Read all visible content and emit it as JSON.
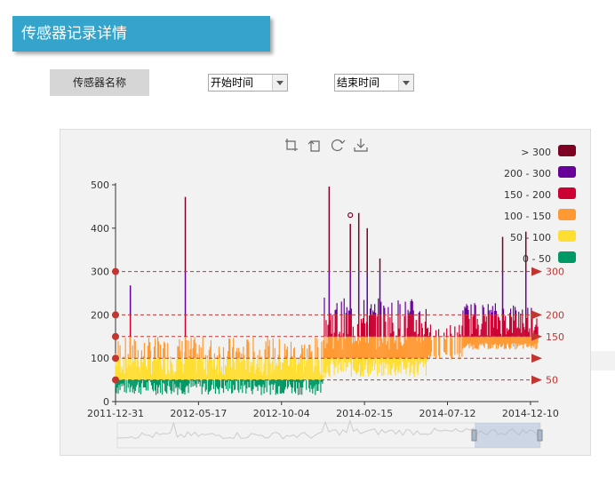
{
  "header": {
    "title": "传感器记录详情"
  },
  "filters": {
    "sensor_name_label": "传感器名称",
    "start_time": "开始时间",
    "end_time": "结束时间"
  },
  "toolbox": [
    "zoom-icon",
    "zoom-reset-icon",
    "restore-icon",
    "download-icon"
  ],
  "colors": {
    "panel_bg": "#f2f2f2",
    "above_300": "#7e0023",
    "200_300": "#660099",
    "150_200": "#cc0033",
    "100_150": "#ff9933",
    "50_100": "#ffde33",
    "0_50": "#096",
    "markline": "#c23531"
  },
  "chart_data": {
    "type": "line",
    "x_ticks": [
      "2011-12-31",
      "2012-05-17",
      "2012-10-04",
      "2014-02-15",
      "2014-07-12",
      "2014-12-10"
    ],
    "y_ticks": [
      0,
      100,
      200,
      300,
      400,
      500
    ],
    "ylim": [
      0,
      500
    ],
    "grid": false,
    "legend_position": "top-right",
    "visual_pieces": [
      {
        "label": "> 300",
        "min": 300,
        "max": 500,
        "color": "#7e0023"
      },
      {
        "label": "200 - 300",
        "min": 200,
        "max": 300,
        "color": "#660099"
      },
      {
        "label": "150 - 200",
        "min": 150,
        "max": 200,
        "color": "#cc0033"
      },
      {
        "label": "100 - 150",
        "min": 100,
        "max": 150,
        "color": "#ff9933"
      },
      {
        "label": "50 - 100",
        "min": 50,
        "max": 100,
        "color": "#ffde33"
      },
      {
        "label": "0 - 50",
        "min": 0,
        "max": 50,
        "color": "#096"
      }
    ],
    "mark_lines": [
      {
        "value": 50,
        "label": "50"
      },
      {
        "value": 100,
        "label": ""
      },
      {
        "value": 150,
        "label": "150"
      },
      {
        "value": 200,
        "label": "200"
      },
      {
        "value": 300,
        "label": "300"
      }
    ],
    "spikes": [
      {
        "x": 0.035,
        "y": 268
      },
      {
        "x": 0.165,
        "y": 472
      },
      {
        "x": 0.505,
        "y": 496
      },
      {
        "x": 0.555,
        "y": 410
      },
      {
        "x": 0.575,
        "y": 435
      },
      {
        "x": 0.595,
        "y": 400
      },
      {
        "x": 0.625,
        "y": 330
      },
      {
        "x": 0.97,
        "y": 392
      },
      {
        "x": 0.915,
        "y": 380
      }
    ],
    "max_point": {
      "x": 0.555,
      "y": 430
    }
  }
}
